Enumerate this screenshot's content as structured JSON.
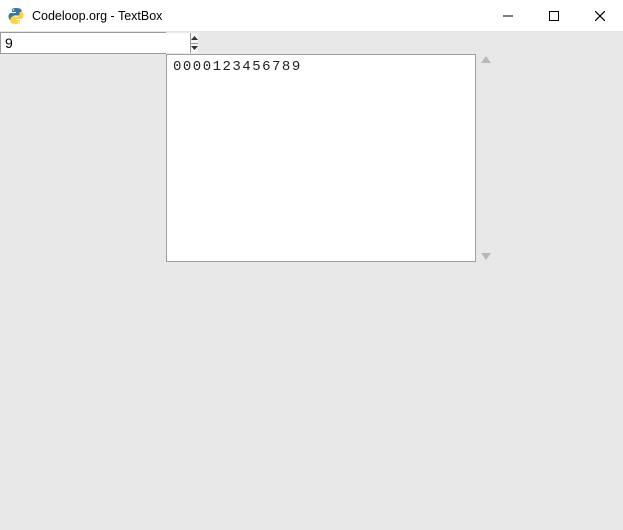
{
  "window": {
    "title": "Codeloop.org - TextBox"
  },
  "spin": {
    "value": "9"
  },
  "textbox": {
    "content": "0000123456789"
  }
}
